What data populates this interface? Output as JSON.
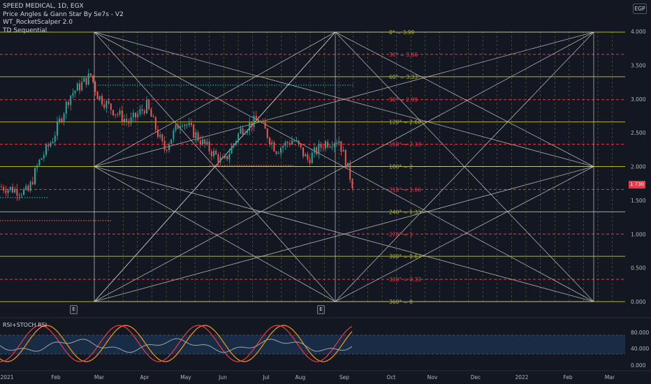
{
  "header": {
    "symbol_line": "SPEED MEDICAL, 1D, EGX",
    "indicators": [
      "Price Angles & Gann Star By Se7s - V2",
      "WT_RocketScalper 2.0",
      "TD Sequential"
    ],
    "currency": "EGP"
  },
  "price_axis": {
    "ticks": [
      "4.000",
      "3.500",
      "3.000",
      "2.500",
      "2.000",
      "1.500",
      "1.000",
      "0.500",
      "0.000"
    ],
    "last_price": "1.730"
  },
  "gann_levels": [
    {
      "label": "0° = 3.99",
      "price": 3.99,
      "color": "#b5b51e"
    },
    {
      "label": "30° = 3.66",
      "price": 3.66,
      "color": "#f23645"
    },
    {
      "label": "60° = 3.33",
      "price": 3.33,
      "color": "#b5b51e"
    },
    {
      "label": "90° = 2.99",
      "price": 2.99,
      "color": "#f23645"
    },
    {
      "label": "120° = 2.66",
      "price": 2.66,
      "color": "#b5b51e"
    },
    {
      "label": "150° = 2.33",
      "price": 2.33,
      "color": "#f23645"
    },
    {
      "label": "180° = 2",
      "price": 2.0,
      "color": "#b5b51e"
    },
    {
      "label": "210° = 1.66",
      "price": 1.66,
      "color": "#f23645"
    },
    {
      "label": "240° = 1.33",
      "price": 1.33,
      "color": "#b5b51e"
    },
    {
      "label": "270° = 1",
      "price": 1.0,
      "color": "#f23645"
    },
    {
      "label": "300° = 0.67",
      "price": 0.67,
      "color": "#b5b51e"
    },
    {
      "label": "330° = 0.33",
      "price": 0.33,
      "color": "#f23645"
    },
    {
      "label": "360° = 0",
      "price": 0.0,
      "color": "#b5b51e"
    }
  ],
  "time_axis": [
    "2021",
    "Feb",
    "Mar",
    "Apr",
    "May",
    "Jun",
    "Jul",
    "Aug",
    "Sep",
    "Oct",
    "Nov",
    "Dec",
    "2022",
    "Feb",
    "Mar"
  ],
  "earnings_marker": "E",
  "rsi_panel": {
    "title": "RSI+STOCH RSI",
    "ticks": [
      "80.000",
      "40.000",
      "0.000"
    ]
  },
  "colors": {
    "background": "#131722",
    "up": "#26a69a",
    "down": "#ef5350",
    "gann_yellow": "#b5b51e",
    "gann_red": "#f23645",
    "rsi_band": "#1e3a5f"
  }
}
